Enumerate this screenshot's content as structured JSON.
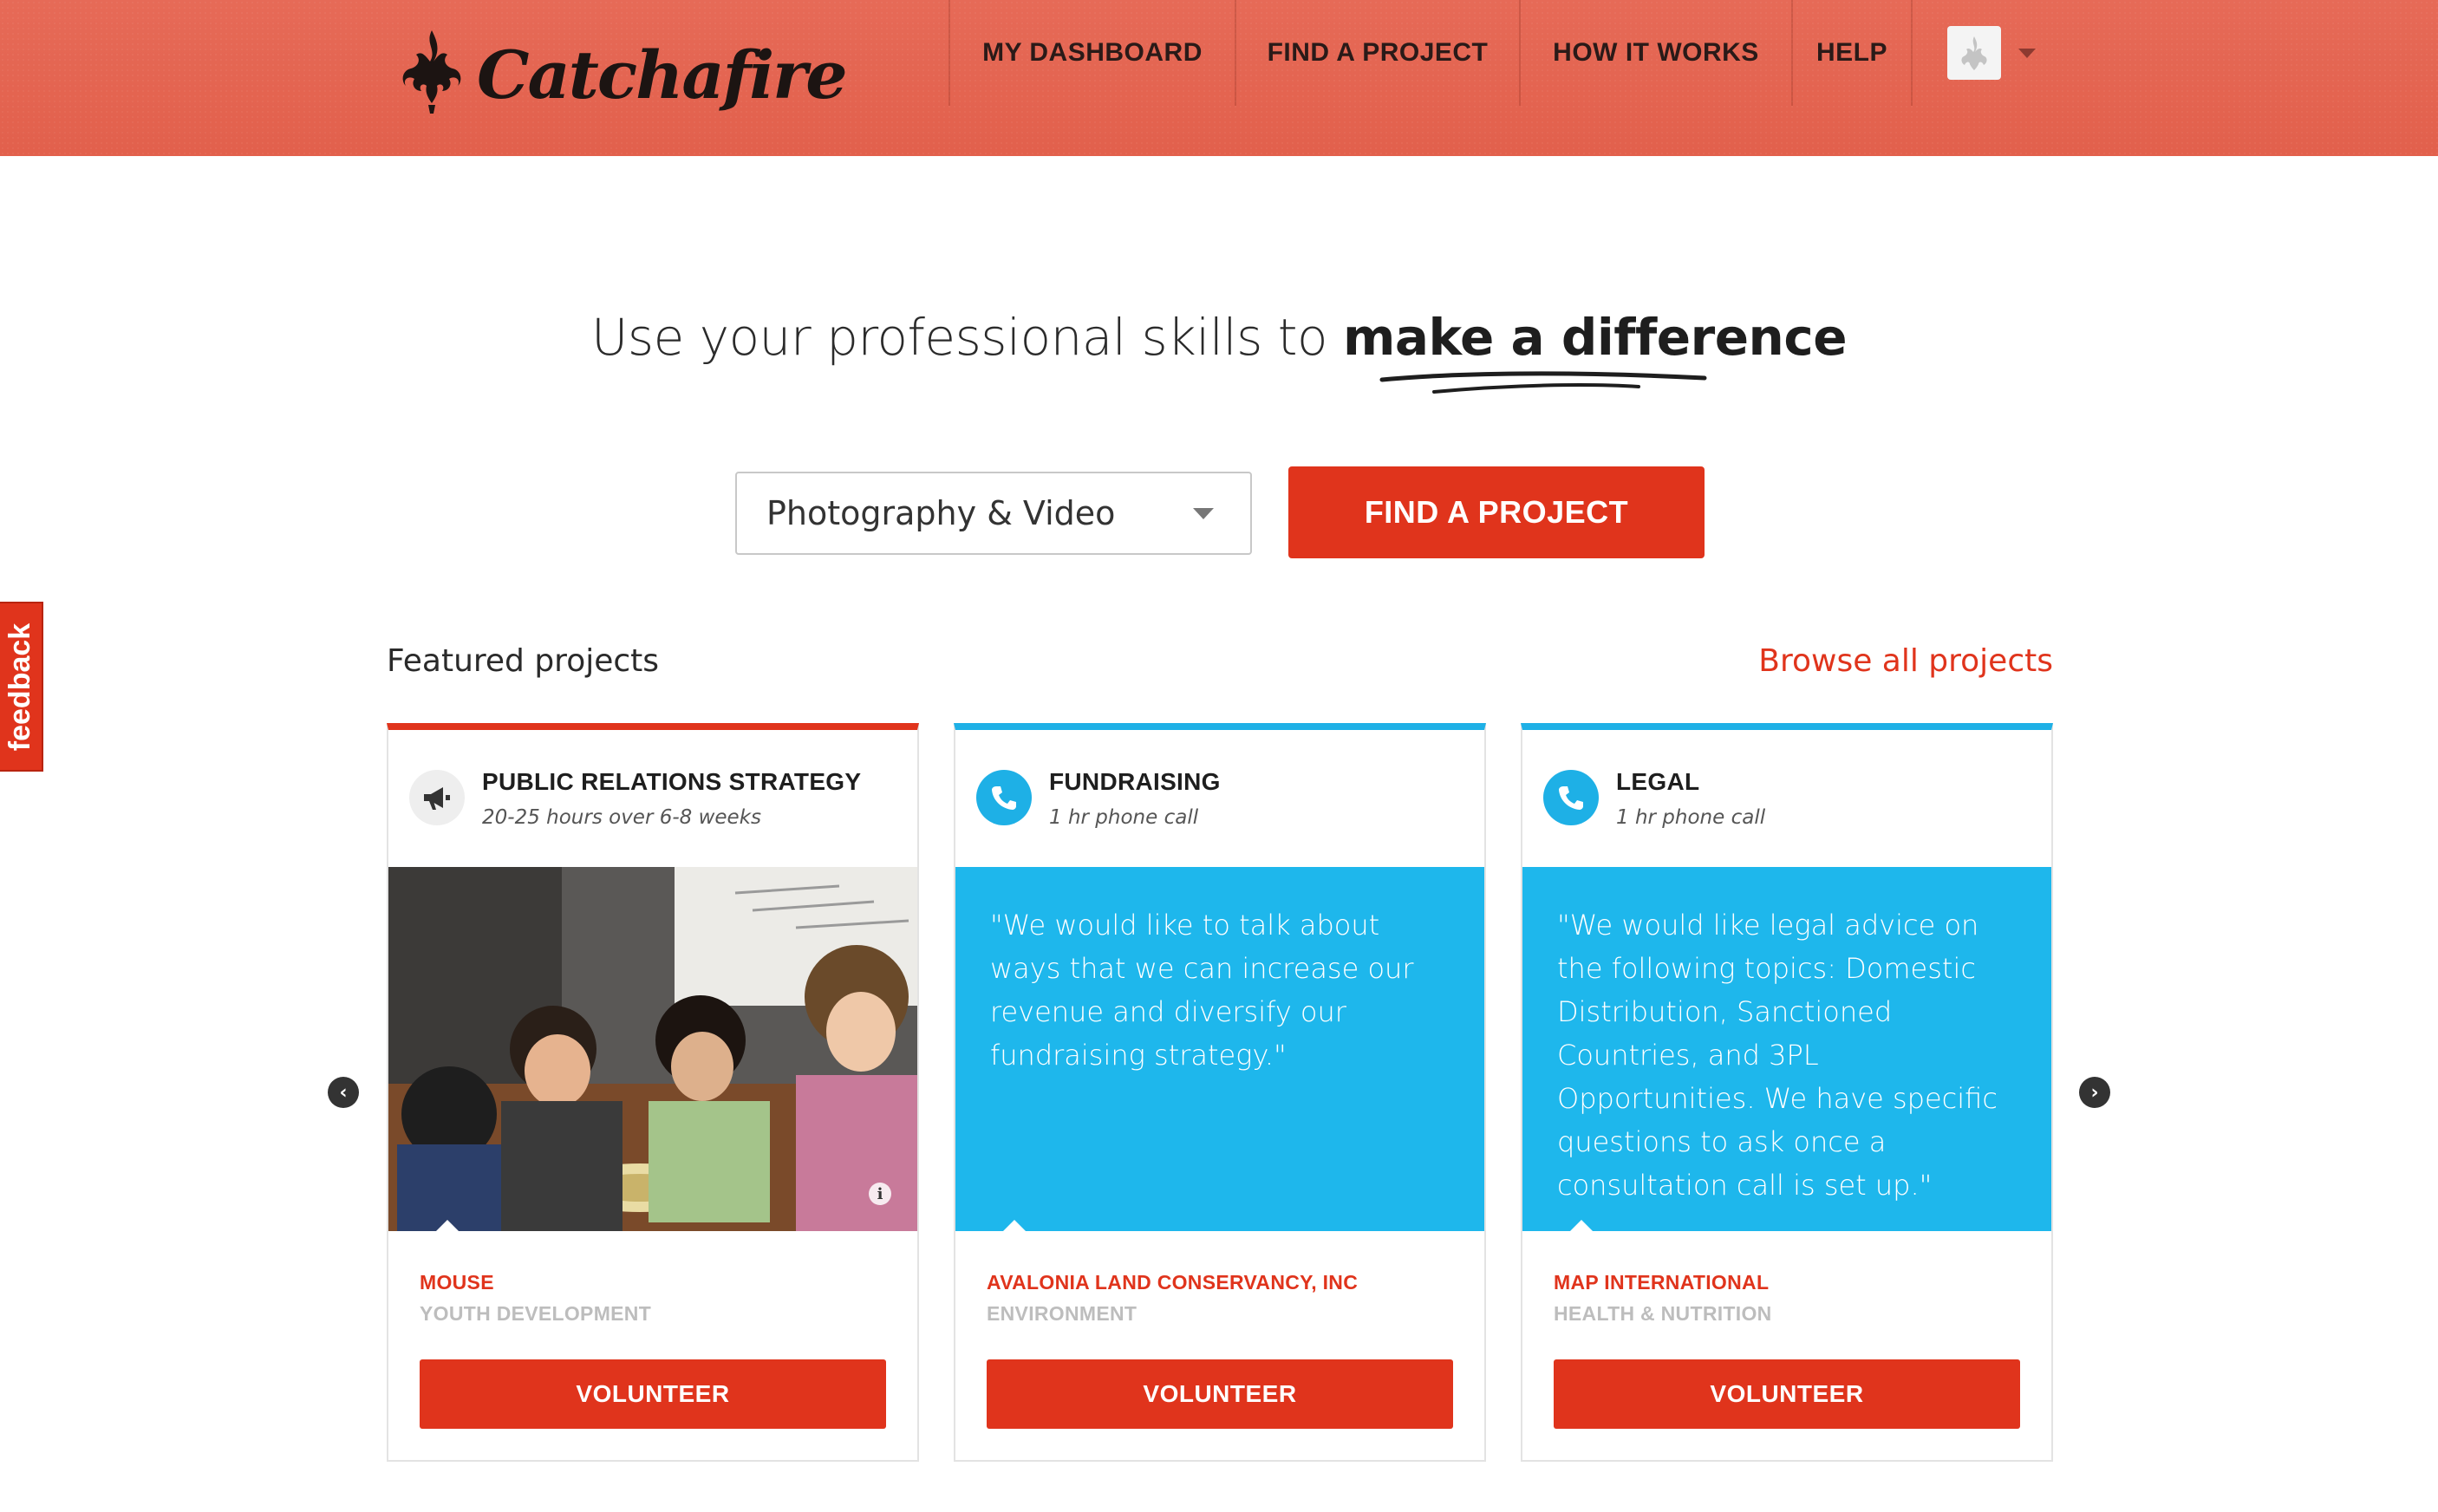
{
  "header": {
    "logo_text": "Catchafire",
    "nav": [
      {
        "label": "MY DASHBOARD"
      },
      {
        "label": "FIND A PROJECT"
      },
      {
        "label": "HOW IT WORKS"
      },
      {
        "label": "HELP"
      }
    ],
    "avatar_icon": "flame-icon"
  },
  "hero": {
    "title_lead": "Use your professional skills to",
    "title_emphasis": "make a difference",
    "select_value": "Photography & Video",
    "find_button": "FIND A PROJECT"
  },
  "feedback_tab": "feedback",
  "featured": {
    "label": "Featured projects",
    "browse_link": "Browse all projects",
    "cards": [
      {
        "title": "PUBLIC RELATIONS STRATEGY",
        "subtitle": "20-25 hours over 6-8 weeks",
        "icon": "megaphone-icon",
        "org": "MOUSE",
        "category": "YOUTH DEVELOPMENT",
        "button": "VOLUNTEER"
      },
      {
        "title": "FUNDRAISING",
        "subtitle": "1 hr phone call",
        "icon": "phone-icon",
        "quote": "\"We would like to talk about ways that we can increase our revenue and diversify our fundraising strategy.\"",
        "org": "AVALONIA LAND CONSERVANCY, INC",
        "category": "ENVIRONMENT",
        "button": "VOLUNTEER"
      },
      {
        "title": "LEGAL",
        "subtitle": "1 hr phone call",
        "icon": "phone-icon",
        "quote": "\"We would like legal advice on the following topics: Domestic Distribution, Sanctioned Countries, and 3PL Opportunities. We have specific questions to ask once a consultation call is set up.\"",
        "org": "MAP INTERNATIONAL",
        "category": "HEALTH & NUTRITION",
        "button": "VOLUNTEER"
      }
    ]
  },
  "colors": {
    "brand_red": "#e0341c",
    "header_red": "#e2604c",
    "accent_blue": "#1eb7ec"
  }
}
